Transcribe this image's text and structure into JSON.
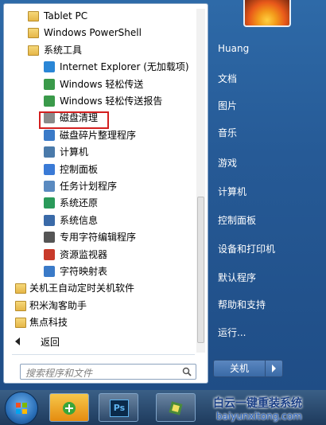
{
  "programs": [
    {
      "label": "Tablet PC",
      "icon": "folder-icon",
      "indent": 0
    },
    {
      "label": "Windows PowerShell",
      "icon": "folder-icon",
      "indent": 0
    },
    {
      "label": "系统工具",
      "icon": "folder-icon",
      "indent": 0
    },
    {
      "label": "Internet Explorer (无加载项)",
      "icon": "ie-icon",
      "indent": 1
    },
    {
      "label": "Windows 轻松传送",
      "icon": "transfer-icon",
      "indent": 1
    },
    {
      "label": "Windows 轻松传送报告",
      "icon": "transfer-report-icon",
      "indent": 1
    },
    {
      "label": "磁盘清理",
      "icon": "disk-cleanup-icon",
      "indent": 1
    },
    {
      "label": "磁盘碎片整理程序",
      "icon": "defrag-icon",
      "indent": 1
    },
    {
      "label": "计算机",
      "icon": "computer-icon",
      "indent": 1
    },
    {
      "label": "控制面板",
      "icon": "control-panel-icon",
      "indent": 1
    },
    {
      "label": "任务计划程序",
      "icon": "task-scheduler-icon",
      "indent": 1
    },
    {
      "label": "系统还原",
      "icon": "system-restore-icon",
      "indent": 1
    },
    {
      "label": "系统信息",
      "icon": "system-info-icon",
      "indent": 1
    },
    {
      "label": "专用字符编辑程序",
      "icon": "char-editor-icon",
      "indent": 1
    },
    {
      "label": "资源监视器",
      "icon": "resource-monitor-icon",
      "indent": 1
    },
    {
      "label": "字符映射表",
      "icon": "char-map-icon",
      "indent": 1
    },
    {
      "label": "关机王自动定时关机软件",
      "icon": "folder-icon",
      "indent": 0
    },
    {
      "label": "积米淘客助手",
      "icon": "folder-icon",
      "indent": 0
    },
    {
      "label": "焦点科技",
      "icon": "folder-icon",
      "indent": 0
    }
  ],
  "back_label": "返回",
  "search_placeholder": "搜索程序和文件",
  "right_items": [
    "Huang",
    "文档",
    "图片",
    "音乐",
    "游戏",
    "计算机",
    "控制面板",
    "设备和打印机",
    "默认程序",
    "帮助和支持",
    "运行..."
  ],
  "shutdown_label": "关机",
  "watermark": {
    "title": "白云一键重装系统",
    "url": "baiyunxitong.com"
  },
  "colors": {
    "highlight": "#d31f1f",
    "accent": "#265a96"
  }
}
